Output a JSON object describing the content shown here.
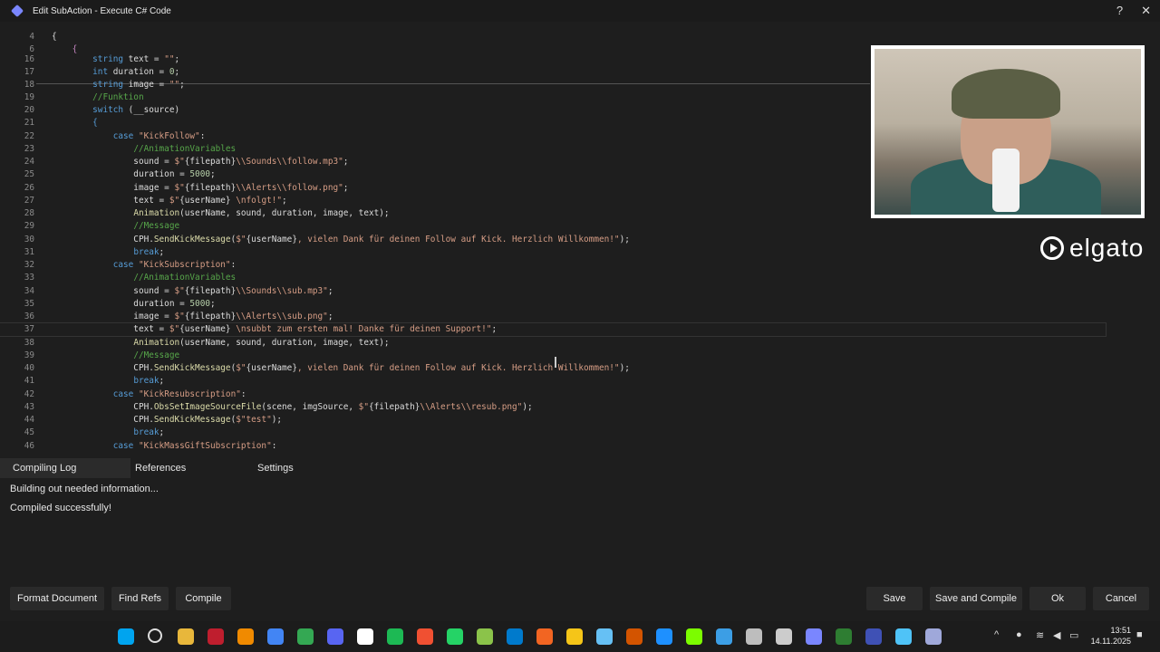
{
  "window": {
    "title": "Edit SubAction - Execute C# Code",
    "help_label": "?",
    "close_label": "✕"
  },
  "code_lines": [
    {
      "num": "4",
      "html": "<span>{</span>"
    },
    {
      "num": "6",
      "html": "    <span style='color:#c586c0'>{</span>"
    },
    {
      "num": "16",
      "html": "        <span class='k'>string</span> text = <span class='s'>\"\"</span>;"
    },
    {
      "num": "17",
      "html": "        <span class='k'>int</span> duration = <span class='n'>0</span>;"
    },
    {
      "num": "18",
      "html": "        <span class='k'>string</span> image = <span class='s'>\"\"</span>;"
    },
    {
      "num": "19",
      "html": "        <span class='c'>//Funktion</span>"
    },
    {
      "num": "20",
      "html": "        <span class='k'>switch</span> (__source)"
    },
    {
      "num": "21",
      "html": "        <span style='color:#569cd6'>{</span>"
    },
    {
      "num": "22",
      "html": "            <span class='k'>case</span> <span class='s'>\"KickFollow\"</span>:"
    },
    {
      "num": "23",
      "html": "                <span class='c'>//AnimationVariables</span>"
    },
    {
      "num": "24",
      "html": "                sound = <span class='s'>$\"</span>{filepath}<span class='s'>\\\\Sounds\\\\follow.mp3\"</span>;"
    },
    {
      "num": "25",
      "html": "                duration = <span class='n'>5000</span>;"
    },
    {
      "num": "26",
      "html": "                image = <span class='s'>$\"</span>{filepath}<span class='s'>\\\\Alerts\\\\follow.png\"</span>;"
    },
    {
      "num": "27",
      "html": "                text = <span class='s'>$\"</span>{userName}<span class='s'> \\nfolgt!\"</span>;"
    },
    {
      "num": "28",
      "html": "                <span class='m'>Animation</span>(userName, sound, duration, image, text);"
    },
    {
      "num": "29",
      "html": "                <span class='c'>//Message</span>"
    },
    {
      "num": "30",
      "html": "                CPH.<span class='m'>SendKickMessage</span>(<span class='s'>$\"</span>{userName}<span class='s'>, vielen Dank für deinen Follow auf Kick. Herzlich Willkommen!\"</span>);"
    },
    {
      "num": "31",
      "html": "                <span class='k'>break</span>;"
    },
    {
      "num": "32",
      "html": "            <span class='k'>case</span> <span class='s'>\"KickSubscription\"</span>:"
    },
    {
      "num": "33",
      "html": "                <span class='c'>//AnimationVariables</span>"
    },
    {
      "num": "34",
      "html": "                sound = <span class='s'>$\"</span>{filepath}<span class='s'>\\\\Sounds\\\\sub.mp3\"</span>;"
    },
    {
      "num": "35",
      "html": "                duration = <span class='n'>5000</span>;"
    },
    {
      "num": "36",
      "html": "                image = <span class='s'>$\"</span>{filepath}<span class='s'>\\\\Alerts\\\\sub.png\"</span>;"
    },
    {
      "num": "37",
      "html": "                text = <span class='s'>$\"</span>{userName}<span class='s'> \\nsubbt zum ersten mal! Danke für deinen Support!\"</span>;"
    },
    {
      "num": "38",
      "html": "                <span class='m'>Animation</span>(userName, sound, duration, image, text);"
    },
    {
      "num": "39",
      "html": "                <span class='c'>//Message</span>"
    },
    {
      "num": "40",
      "html": "                CPH.<span class='m'>SendKickMessage</span>(<span class='s'>$\"</span>{userName}<span class='s'>, vielen Dank für deinen Follow auf Kick. Herzlich Willkommen!\"</span>);"
    },
    {
      "num": "41",
      "html": "                <span class='k'>break</span>;"
    },
    {
      "num": "42",
      "html": "            <span class='k'>case</span> <span class='s'>\"KickResubscription\"</span>:"
    },
    {
      "num": "43",
      "html": "                CPH.<span class='m'>ObsSetImageSourceFile</span>(scene, imgSource, <span class='s'>$\"</span>{filepath}<span class='s'>\\\\Alerts\\\\resub.png\"</span>);"
    },
    {
      "num": "44",
      "html": "                CPH.<span class='m'>SendKickMessage</span>(<span class='s'>$\"test\"</span>);"
    },
    {
      "num": "45",
      "html": "                <span class='k'>break</span>;"
    },
    {
      "num": "46",
      "html": "            <span class='k'>case</span> <span class='s'>\"KickMassGiftSubscription\"</span>:"
    }
  ],
  "overlay": {
    "brand": "elgato"
  },
  "tabs": [
    "Compiling Log",
    "References",
    "Settings"
  ],
  "log": [
    "Building out needed information...",
    "Compiled successfully!"
  ],
  "buttons": {
    "format": "Format Document",
    "find_refs": "Find Refs",
    "compile": "Compile",
    "save": "Save",
    "save_compile": "Save and Compile",
    "ok": "Ok",
    "cancel": "Cancel"
  },
  "taskbar": {
    "time": "13:51",
    "date": "14.11.2025",
    "icons": [
      "windows-start",
      "search",
      "file-explorer",
      "filezilla",
      "vlc",
      "chrome",
      "chrome-alt",
      "discord",
      "epic-games",
      "spotify",
      "git",
      "whatsapp",
      "notepad-plus",
      "vscode",
      "app-a",
      "app-r",
      "steam",
      "app-x",
      "app-blue",
      "app-cube",
      "app-bubble",
      "app-move",
      "obs",
      "streamerbot",
      "app-grid",
      "app-pill",
      "notepad",
      "audio-app"
    ],
    "icon_colors": [
      "#00a4ef",
      "#dddddd",
      "#e8b73b",
      "#bf1e2e",
      "#f08a00",
      "#4285f4",
      "#34a853",
      "#5865f2",
      "#ffffff",
      "#1db954",
      "#f05032",
      "#25d366",
      "#8bc34a",
      "#007acc",
      "#f26522",
      "#f5c518",
      "#66c0f4",
      "#d35400",
      "#1e90ff",
      "#7cfc00",
      "#3c9ee5",
      "#bdbdbd",
      "#cccccc",
      "#7a86ff",
      "#2e7d32",
      "#3f51b5",
      "#4fc3f7",
      "#9fa8da"
    ]
  }
}
